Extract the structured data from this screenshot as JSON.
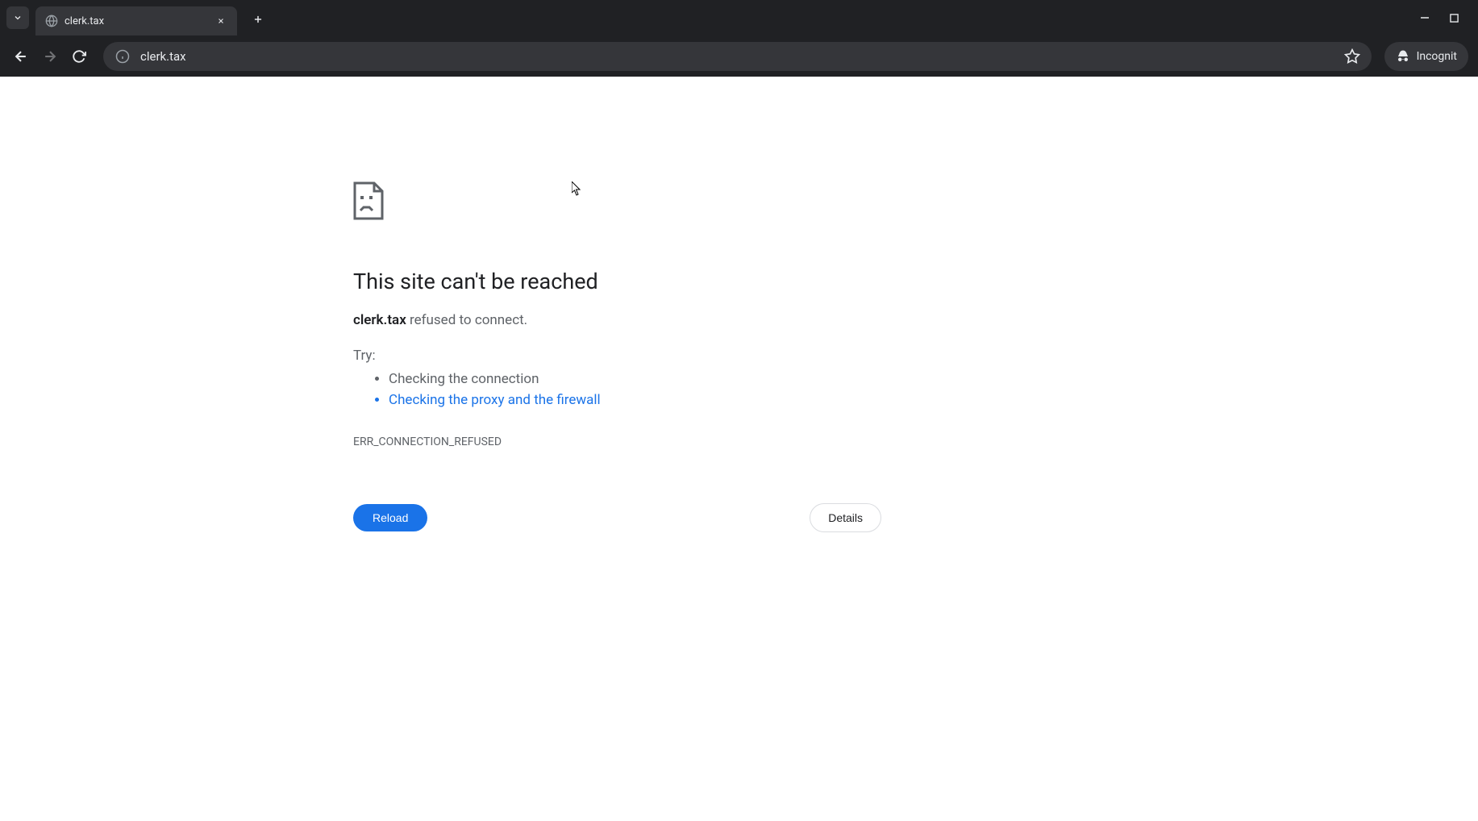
{
  "browser": {
    "tab_title": "clerk.tax",
    "url": "clerk.tax",
    "incognito_label": "Incognit"
  },
  "error": {
    "title": "This site can't be reached",
    "host": "clerk.tax",
    "message_suffix": " refused to connect.",
    "try_label": "Try:",
    "suggestions": {
      "connection": "Checking the connection",
      "proxy": "Checking the proxy and the firewall"
    },
    "code": "ERR_CONNECTION_REFUSED",
    "reload_label": "Reload",
    "details_label": "Details"
  }
}
